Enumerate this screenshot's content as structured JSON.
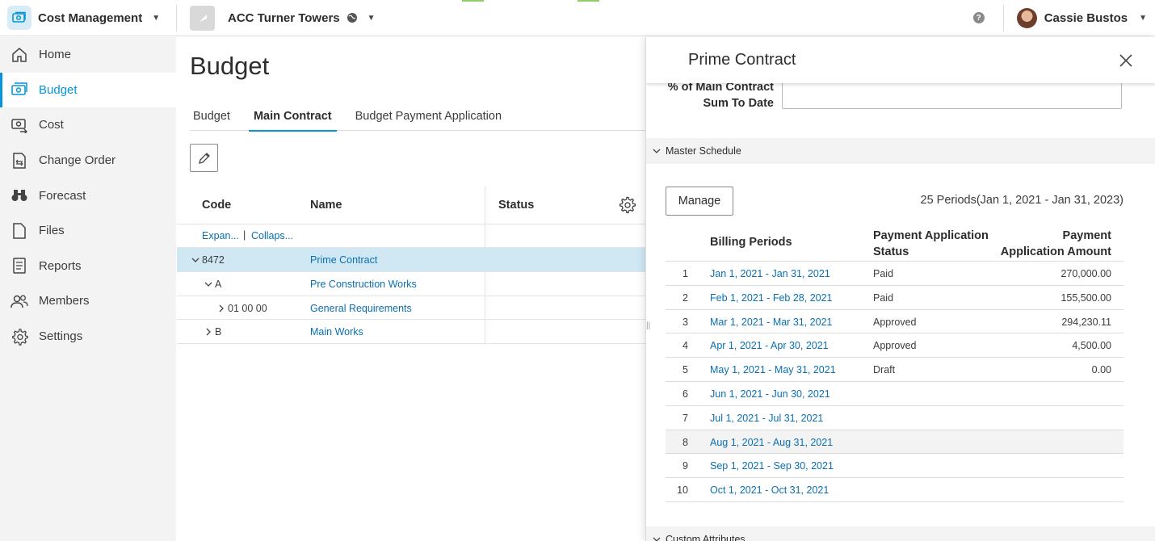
{
  "topbar": {
    "app_title": "Cost Management",
    "project_name": "ACC Turner Towers",
    "user_name": "Cassie Bustos"
  },
  "sidebar": {
    "items": [
      {
        "label": "Home",
        "icon": "home-icon"
      },
      {
        "label": "Budget",
        "icon": "budget-icon",
        "active": true
      },
      {
        "label": "Cost",
        "icon": "cost-icon"
      },
      {
        "label": "Change Order",
        "icon": "change-order-icon"
      },
      {
        "label": "Forecast",
        "icon": "binoculars-icon"
      },
      {
        "label": "Files",
        "icon": "file-icon"
      },
      {
        "label": "Reports",
        "icon": "reports-icon"
      },
      {
        "label": "Members",
        "icon": "members-icon"
      },
      {
        "label": "Settings",
        "icon": "gear-icon"
      }
    ]
  },
  "main": {
    "title": "Budget",
    "tabs": [
      {
        "label": "Budget"
      },
      {
        "label": "Main Contract",
        "active": true
      },
      {
        "label": "Budget Payment Application"
      }
    ],
    "grid": {
      "headers": {
        "code": "Code",
        "name": "Name",
        "status": "Status"
      },
      "expand_label": "Expan...",
      "collapse_label": "Collaps...",
      "separator": "|",
      "rows": [
        {
          "code": "8472",
          "name": "Prime Contract",
          "selected": true
        },
        {
          "code": "A",
          "name": "Pre Construction Works"
        },
        {
          "code": "01 00 00",
          "name": "General Requirements"
        },
        {
          "code": "B",
          "name": "Main Works"
        }
      ]
    }
  },
  "panel": {
    "title": "Prime Contract",
    "field_label": "% of Main Contract Sum To Date",
    "field_value": "",
    "master_schedule_label": "Master Schedule",
    "manage_label": "Manage",
    "periods_info": "25 Periods(Jan 1, 2021 - Jan 31, 2023)",
    "schedule_headers": {
      "billing": "Billing Periods",
      "status_line1": "Payment Application",
      "status_line2": "Status",
      "amount_line1": "Payment",
      "amount_line2": "Application Amount"
    },
    "schedule_rows": [
      {
        "num": "1",
        "period": "Jan 1, 2021 - Jan 31, 2021",
        "status": "Paid",
        "amount": "270,000.00"
      },
      {
        "num": "2",
        "period": "Feb 1, 2021 - Feb 28, 2021",
        "status": "Paid",
        "amount": "155,500.00"
      },
      {
        "num": "3",
        "period": "Mar 1, 2021 - Mar 31, 2021",
        "status": "Approved",
        "amount": "294,230.11"
      },
      {
        "num": "4",
        "period": "Apr 1, 2021 - Apr 30, 2021",
        "status": "Approved",
        "amount": "4,500.00"
      },
      {
        "num": "5",
        "period": "May 1, 2021 - May 31, 2021",
        "status": "Draft",
        "amount": "0.00"
      },
      {
        "num": "6",
        "period": "Jun 1, 2021 - Jun 30, 2021",
        "status": "",
        "amount": ""
      },
      {
        "num": "7",
        "period": "Jul 1, 2021 - Jul 31, 2021",
        "status": "",
        "amount": ""
      },
      {
        "num": "8",
        "period": "Aug 1, 2021 - Aug 31, 2021",
        "status": "",
        "amount": "",
        "highlighted": true
      },
      {
        "num": "9",
        "period": "Sep 1, 2021 - Sep 30, 2021",
        "status": "",
        "amount": ""
      },
      {
        "num": "10",
        "period": "Oct 1, 2021 - Oct 31, 2021",
        "status": "",
        "amount": ""
      }
    ],
    "custom_attributes_label": "Custom Attributes"
  },
  "colors": {
    "accent": "#0696d7",
    "link": "#0a6fb0",
    "selected_row": "#d0e8f4",
    "sidebar_bg": "#f3f3f3"
  }
}
